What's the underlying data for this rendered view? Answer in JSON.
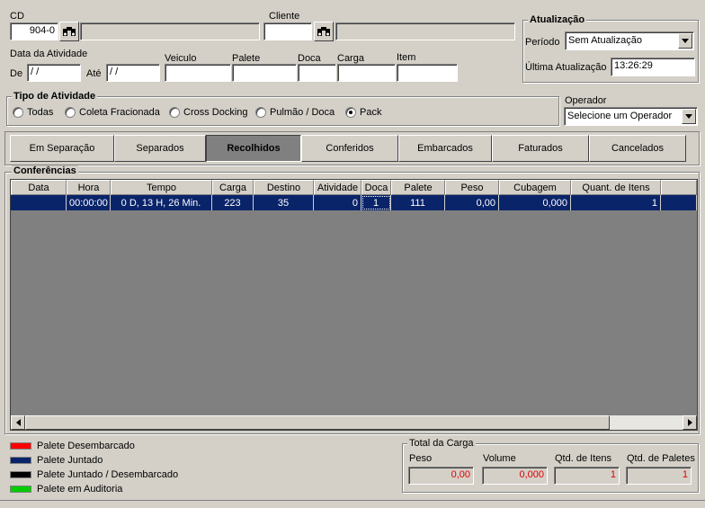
{
  "cd": {
    "label": "CD",
    "value": "904-0",
    "name_value": ""
  },
  "cliente": {
    "label": "Cliente",
    "value": "",
    "name_value": ""
  },
  "data_atividade": {
    "label": "Data da Atividade",
    "de_label": "De",
    "de_value": " / /",
    "ate_label": "Até",
    "ate_value": " / /"
  },
  "filters": {
    "veiculo": {
      "label": "Veiculo",
      "value": ""
    },
    "palete": {
      "label": "Palete",
      "value": ""
    },
    "doca": {
      "label": "Doca",
      "value": ""
    },
    "carga": {
      "label": "Carga",
      "value": ""
    },
    "item": {
      "label": "Item",
      "value": ""
    }
  },
  "atualizacao": {
    "title": "Atualização",
    "periodo_label": "Período",
    "periodo_value": "Sem Atualização",
    "ultima_label": "Última Atualização",
    "ultima_value": "13:26:29"
  },
  "tipo_atividade": {
    "title": "Tipo de Atividade",
    "options": [
      "Todas",
      "Coleta Fracionada",
      "Cross Docking",
      "Pulmão / Doca",
      "Pack"
    ],
    "selected": "Pack"
  },
  "operador": {
    "label": "Operador",
    "value": "Selecione um Operador"
  },
  "tabs": [
    "Em Separação",
    "Separados",
    "Recolhidos",
    "Conferidos",
    "Embarcados",
    "Faturados",
    "Cancelados"
  ],
  "active_tab": "Recolhidos",
  "conferencias": {
    "title": "Conferências",
    "columns": [
      "Data",
      "Hora",
      "Tempo",
      "Carga",
      "Destino",
      "Atividade",
      "Doca",
      "Palete",
      "Peso",
      "Cubagem",
      "Quant. de Itens"
    ],
    "rows": [
      {
        "data": "",
        "hora": "00:00:00",
        "tempo": "0 D, 13 H, 26 Min.",
        "carga": "223",
        "destino": "35",
        "atividade": "0",
        "doca": "1",
        "palete": "111",
        "peso": "0,00",
        "cubagem": "0,000",
        "quant": "1"
      }
    ]
  },
  "legend": [
    {
      "label": "Palete Desembarcado",
      "color": "#ff0000"
    },
    {
      "label": "Palete Juntado",
      "color": "#0a246a"
    },
    {
      "label": "Palete Juntado / Desembarcado",
      "color": "#000000"
    },
    {
      "label": "Palete em Auditoria",
      "color": "#00cc00"
    }
  ],
  "total_carga": {
    "title": "Total da Carga",
    "peso_label": "Peso",
    "peso_value": "0,00",
    "volume_label": "Volume",
    "volume_value": "0,000",
    "itens_label": "Qtd. de Itens",
    "itens_value": "1",
    "paletes_label": "Qtd. de Paletes",
    "paletes_value": "1"
  },
  "icons": {
    "search": "binoculars-icon",
    "dropdown": "chevron-down-icon",
    "scroll_left": "arrow-left-icon",
    "scroll_right": "arrow-right-icon"
  }
}
